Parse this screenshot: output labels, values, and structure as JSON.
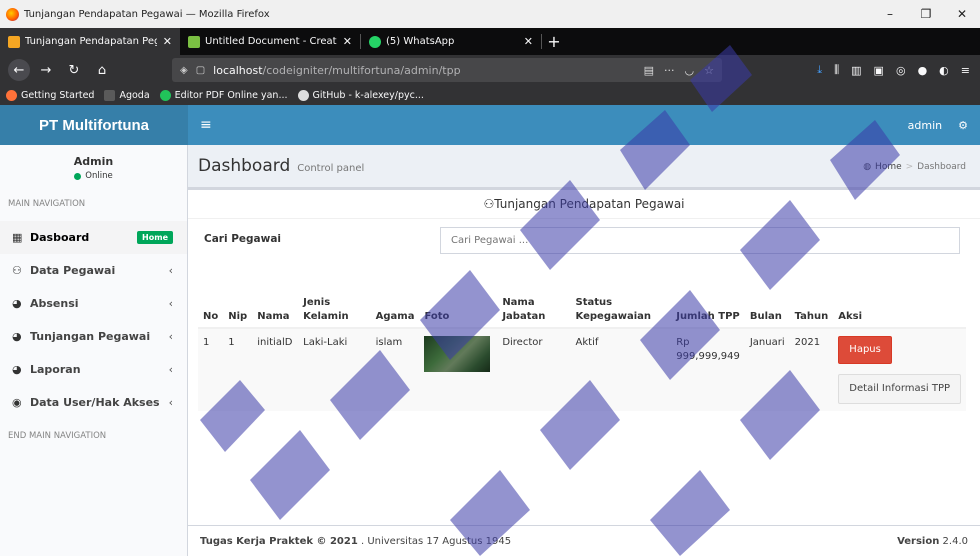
{
  "window": {
    "title": "Tunjangan Pendapatan Pegawai — Mozilla Firefox",
    "controls": [
      "–",
      "❐",
      "✕"
    ]
  },
  "tabs": [
    {
      "label": "Tunjangan Pendapatan Pegawai",
      "icon_color": "#f5a623",
      "active": true
    },
    {
      "label": "Untitled Document - Creately",
      "icon_color": "#7bc043",
      "active": false
    },
    {
      "label": "(5) WhatsApp",
      "icon_color": "#25d366",
      "active": false
    }
  ],
  "nav": {
    "url_host": "localhost",
    "url_path": "/codeigniter/multifortuna/admin/tpp",
    "more": "···"
  },
  "bookmarks": [
    {
      "label": "Getting Started",
      "icon_color": "#ff7139"
    },
    {
      "label": "Agoda",
      "icon_color": "#5a5a5a"
    },
    {
      "label": "Editor PDF Online yan...",
      "icon_color": "#21c35a"
    },
    {
      "label": "GitHub - k-alexey/pyc...",
      "icon_color": "#dddddd"
    }
  ],
  "header": {
    "logo": "PT Multifortuna",
    "user": "admin"
  },
  "sidebar": {
    "user_name": "Admin",
    "user_status": "Online",
    "nav_header": "MAIN NAVIGATION",
    "items": [
      {
        "label": "Dasboard",
        "icon": "th-icon",
        "glyph": "▦",
        "badge": "Home",
        "active": true
      },
      {
        "label": "Data Pegawai",
        "icon": "users-icon",
        "glyph": "⚇",
        "chevron": "‹"
      },
      {
        "label": "Absensi",
        "icon": "pie-chart-icon",
        "glyph": "◕",
        "chevron": "‹"
      },
      {
        "label": "Tunjangan Pegawai",
        "icon": "pie-chart-icon",
        "glyph": "◕",
        "chevron": "‹"
      },
      {
        "label": "Laporan",
        "icon": "pie-chart-icon",
        "glyph": "◕",
        "chevron": "‹"
      },
      {
        "label": "Data User/Hak Akses",
        "icon": "user-secret-icon",
        "glyph": "◉",
        "chevron": "‹"
      }
    ],
    "footer": "END MAIN NAVIGATION"
  },
  "content": {
    "title": "Dashboard",
    "subtitle": "Control panel",
    "breadcrumb_home": "Home",
    "breadcrumb_current": "Dashboard",
    "box_title": "Tunjangan Pendapatan Pegawai",
    "search_label": "Cari Pegawai",
    "search_placeholder": "Cari Pegawai ...",
    "table": {
      "headers": [
        "No",
        "Nip",
        "Nama",
        "Jenis Kelamin",
        "Agama",
        "Foto",
        "Nama Jabatan",
        "Status Kepegawaian",
        "Jumlah TPP",
        "Bulan",
        "Tahun",
        "Aksi"
      ],
      "rows": [
        {
          "no": "1",
          "nip": "1",
          "nama": "initialD",
          "jenis_kelamin": "Laki-Laki",
          "agama": "islam",
          "nama_jabatan": "Director",
          "status": "Aktif",
          "jumlah_tpp": "Rp 999,999,949",
          "bulan": "Januari",
          "tahun": "2021",
          "hapus": "Hapus",
          "detail": "Detail Informasi TPP"
        }
      ]
    }
  },
  "footer": {
    "left_bold": "Tugas Kerja Praktek © 2021",
    "left_rest": " . Universitas 17 Agustus 1945",
    "version_label": "Version",
    "version": "2.4.0"
  }
}
